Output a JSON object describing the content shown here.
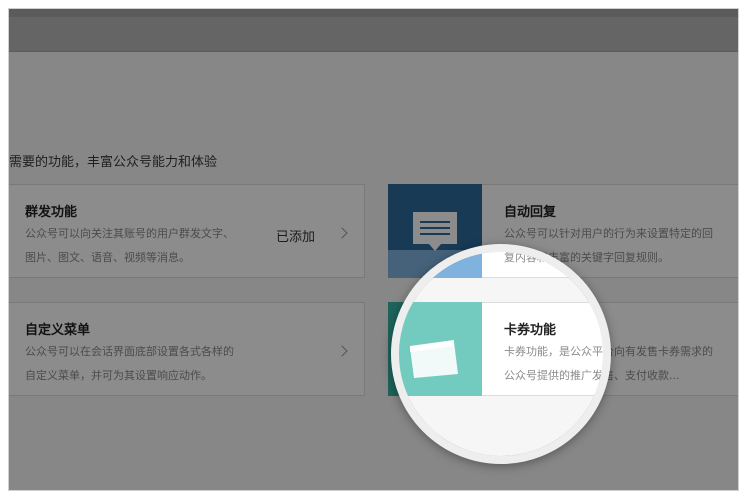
{
  "intro": "需要的功能，丰富公众号能力和体验",
  "features": {
    "mass_send": {
      "title": "群发功能",
      "desc_line1": "公众号可以向关注其账号的用户群发文字、",
      "desc_line2": "图片、图文、语音、视频等消息。",
      "status": "已添加"
    },
    "auto_reply": {
      "title": "自动回复",
      "desc_line1": "公众号可以针对用户的行为来设置特定的回",
      "desc_line2": "复内容和丰富的关键字回复规则。"
    },
    "custom_menu": {
      "title": "自定义菜单",
      "desc_line1": "公众号可以在会话界面底部设置各式各样的",
      "desc_line2": "自定义菜单，并可为其设置响应动作。"
    },
    "card_coupon": {
      "title": "卡券功能",
      "desc_line1": "卡券功能，是公众平台向有发售卡券需求的",
      "desc_line2": "公众号提供的推广发售、支付收款..."
    }
  },
  "icons": {
    "auto_reply": "message-icon",
    "card_coupon": "card-icon",
    "chevron": "chevron-right-icon"
  },
  "colors": {
    "auto_reply_icon_bg": "#2c6a9c",
    "auto_reply_icon_bg_light": "#7fb3de",
    "card_icon_bg": "#37b7a6",
    "card_icon_bg_light": "#73cbbf"
  }
}
